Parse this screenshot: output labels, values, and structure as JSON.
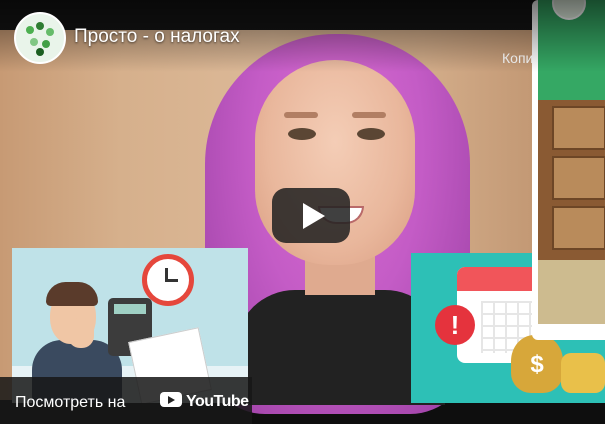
{
  "header": {
    "title": "Просто - о налогах",
    "copy_link": "Копировать ссылку"
  },
  "watch_on": {
    "label": "Посмотреть на",
    "brand": "YouTube"
  },
  "illustration": {
    "money_symbol": "$",
    "alert_symbol": "!"
  },
  "colors": {
    "hair": "#c45cc6",
    "play_button": "#212121",
    "left_illustration_bg": "#bfe2e8",
    "right_illustration_bg": "#2dc0b6",
    "card_green": "#35a864"
  },
  "icons": [
    "channel-logo-icon",
    "play-icon",
    "youtube-logo-icon",
    "alarm-clock-icon",
    "calculator-icon",
    "calendar-icon",
    "money-bag-icon"
  ]
}
